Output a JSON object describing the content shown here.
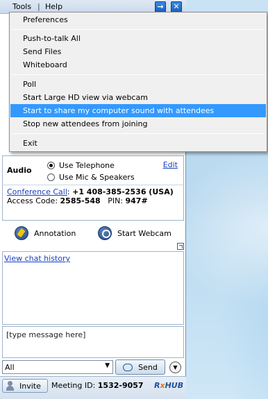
{
  "menubar": {
    "tools_label": "Tools",
    "help_label": "Help",
    "separator": "|"
  },
  "title_buttons": {
    "arrow_glyph": "→",
    "close_glyph": "✕"
  },
  "tools_menu": {
    "items": [
      "Preferences",
      "Push-to-talk All",
      "Send Files",
      "Whiteboard",
      "Poll",
      "Start Large HD view via webcam",
      "Start to share my computer sound with attendees",
      "Stop new attendees from joining",
      "Exit"
    ],
    "highlighted": "Start to share my computer sound with attendees"
  },
  "audio": {
    "label": "Audio",
    "option_telephone": "Use Telephone",
    "option_mic": "Use Mic & Speakers",
    "selected": "Use Telephone",
    "edit_link": "Edit"
  },
  "conference": {
    "call_link": "Conference Call",
    "colon": ":",
    "phone": "+1 408-385-2536 (USA)",
    "access_code_label": "Access Code:",
    "access_code": "2585-548",
    "pin_label": "PIN:",
    "pin": "947#"
  },
  "tools_row": {
    "annotation_label": "Annotation",
    "webcam_label": "Start Webcam"
  },
  "chat": {
    "history_link": "View chat history",
    "input_placeholder": "[type message here]",
    "recipient": "All",
    "send_label": "Send"
  },
  "footer": {
    "invite_label": "Invite",
    "meeting_id_label": "Meeting ID:",
    "meeting_id": "1532-9057",
    "brand_r": "R",
    "brand_x": "x",
    "brand_hub": "HUB"
  },
  "colors": {
    "highlight": "#3399ff",
    "link": "#1a3fbf",
    "brand_blue": "#1f4f9c",
    "brand_orange": "#e2741a"
  }
}
